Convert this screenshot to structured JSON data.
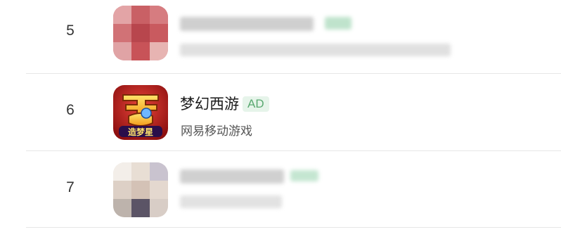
{
  "rows": [
    {
      "rank": "5",
      "blurred": true
    },
    {
      "rank": "6",
      "title": "梦幻西游",
      "badge": "AD",
      "subtitle": "网易移动游戏",
      "icon": "dream-west-journey-app-icon",
      "icon_text": "造梦星"
    },
    {
      "rank": "7",
      "blurred": true
    }
  ],
  "colors": {
    "badge_bg": "#e6f4ea",
    "badge_text": "#5aa971",
    "divider": "#e6e6e6"
  }
}
